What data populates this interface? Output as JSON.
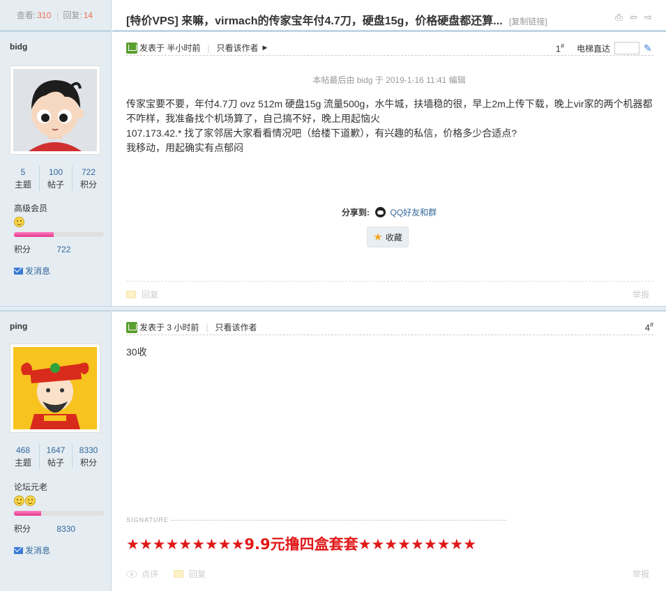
{
  "thread": {
    "views_label": "查看:",
    "views": "310",
    "replies_label": "回复:",
    "replies": "14",
    "title": "[特价VPS] 来嘛，virmach的传家宝年付4.7刀，硬盘15g，价格硬盘都还算...",
    "copy_link": "[复制链接]"
  },
  "posts": [
    {
      "author": "bidg",
      "stats": [
        {
          "value": "5",
          "label": "主题"
        },
        {
          "value": "100",
          "label": "帖子"
        },
        {
          "value": "722",
          "label": "积分"
        }
      ],
      "rank": "高级会员",
      "rank_icons": 1,
      "progress": 0.44,
      "points_label": "积分",
      "points": "722",
      "message_label": "发消息",
      "posted": "发表于 半小时前",
      "only_author": "只看该作者",
      "floor": "1",
      "floor_sup": "#",
      "elevator": "电梯直达",
      "edited": "本帖最后由 bidg 于 2019-1-16 11:41 编辑",
      "content": [
        "传家宝要不要，年付4.7刀  ovz 512m 硬盘15g 流量500g，水牛城，扶墙稳的很，早上2m上传下载，晚上vir家的两个机器都不咋样，我准备找个机场算了，自己搞不好，晚上用起恼火",
        "107.173.42.* 找了家邻居大家看看情况吧（给楼下道歉），有兴趣的私信，价格多少合适点?",
        "我移动，用起确实有点郁闷"
      ],
      "share_label": "分享到:",
      "share_qq": "QQ好友和群",
      "favorite": "收藏",
      "reply": "回复",
      "report": "举报"
    },
    {
      "author": "ping",
      "stats": [
        {
          "value": "468",
          "label": "主题"
        },
        {
          "value": "1647",
          "label": "帖子"
        },
        {
          "value": "8330",
          "label": "积分"
        }
      ],
      "rank": "论坛元老",
      "rank_icons": 2,
      "progress": 0.3,
      "points_label": "积分",
      "points": "8330",
      "message_label": "发消息",
      "posted": "发表于 3 小时前",
      "only_author": "只看该作者",
      "floor": "4",
      "floor_sup": "#",
      "content": [
        "30收"
      ],
      "signature_label": "SIGNATURE",
      "signature": "★★★★★★★★★9.9元撸四盒套套★★★★★★★★★",
      "rate": "点评",
      "reply": "回复",
      "report": "举报"
    }
  ],
  "colors": {
    "sidebar": "#e5edf2",
    "border": "#c2d5e3",
    "link": "#336699",
    "accent": "#f26c4f",
    "signature": "#e01818"
  },
  "icons": [
    "print-icon",
    "prev-thread-icon",
    "next-thread-icon",
    "post-icon",
    "pen-icon",
    "qq-icon",
    "star-icon",
    "mail-icon",
    "reply-icon",
    "eye-icon",
    "smiley-icon"
  ]
}
